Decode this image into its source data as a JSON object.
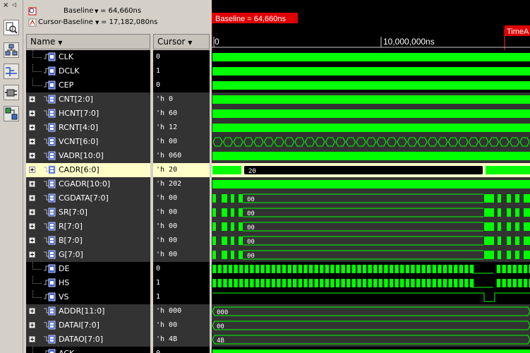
{
  "header": {
    "baseline_label": "Baseline",
    "baseline_value": "= 64,660ns",
    "cursor_label": "Cursor-Baseline",
    "cursor_value": "= 17,182,080ns",
    "close_glyph": "×",
    "pin_glyph": "◁"
  },
  "columns": {
    "name": "Name",
    "cursor": "Cursor"
  },
  "timeline": {
    "baseline_flag": "Baseline = 64,660ns",
    "cursor_flag": "TimeA",
    "tick0": "0",
    "tick1": "10,000,000ns"
  },
  "colors": {
    "wave": "#00ff00",
    "highlight": "#ffffc8",
    "cursor": "#ff3030",
    "baseline": "#e00000"
  },
  "signals": [
    {
      "name": "CLK",
      "cursor": "0",
      "bus": false,
      "wave": "dense"
    },
    {
      "name": "DCLK",
      "cursor": "1",
      "bus": false,
      "wave": "dense"
    },
    {
      "name": "CEP",
      "cursor": "0",
      "bus": false,
      "wave": "dense"
    },
    {
      "name": "CNT[2:0]",
      "cursor": "'h 0",
      "bus": true,
      "wave": "dense"
    },
    {
      "name": "HCNT[7:0]",
      "cursor": "'h 60",
      "bus": true,
      "wave": "dense"
    },
    {
      "name": "RCNT[4:0]",
      "cursor": "'h 12",
      "bus": true,
      "wave": "dense"
    },
    {
      "name": "VCNT[6:0]",
      "cursor": "'h 00",
      "bus": true,
      "wave": "segments"
    },
    {
      "name": "VADR[10:0]",
      "cursor": "'h 060",
      "bus": true,
      "wave": "dense"
    },
    {
      "name": "CADR[6:0]",
      "cursor": "'h 20",
      "bus": true,
      "wave": "cadr",
      "label": "20",
      "selected": true
    },
    {
      "name": "CGADR[10:0]",
      "cursor": "'h 202",
      "bus": true,
      "wave": "dense"
    },
    {
      "name": "CGDATA[7:0]",
      "cursor": "'h 00",
      "bus": true,
      "wave": "bursty",
      "label": "00"
    },
    {
      "name": "SR[7:0]",
      "cursor": "'h 00",
      "bus": true,
      "wave": "bursty",
      "label": "00"
    },
    {
      "name": "R[7:0]",
      "cursor": "'h 00",
      "bus": true,
      "wave": "bursty",
      "label": "00"
    },
    {
      "name": "B[7:0]",
      "cursor": "'h 00",
      "bus": true,
      "wave": "bursty",
      "label": "00"
    },
    {
      "name": "G[7:0]",
      "cursor": "'h 00",
      "bus": true,
      "wave": "bursty",
      "label": "00"
    },
    {
      "name": "DE",
      "cursor": "0",
      "bus": false,
      "wave": "pulses"
    },
    {
      "name": "HS",
      "cursor": "1",
      "bus": false,
      "wave": "pulses"
    },
    {
      "name": "VS",
      "cursor": "1",
      "bus": false,
      "wave": "vs"
    },
    {
      "name": "ADDR[11:0]",
      "cursor": "'h 000",
      "bus": true,
      "wave": "const",
      "label": "000"
    },
    {
      "name": "DATAI[7:0]",
      "cursor": "'h 00",
      "bus": true,
      "wave": "const",
      "label": "00"
    },
    {
      "name": "DATAO[7:0]",
      "cursor": "'h 4B",
      "bus": true,
      "wave": "const",
      "label": "4B"
    },
    {
      "name": "ACK",
      "cursor": "0",
      "bus": false,
      "wave": "partial"
    }
  ]
}
